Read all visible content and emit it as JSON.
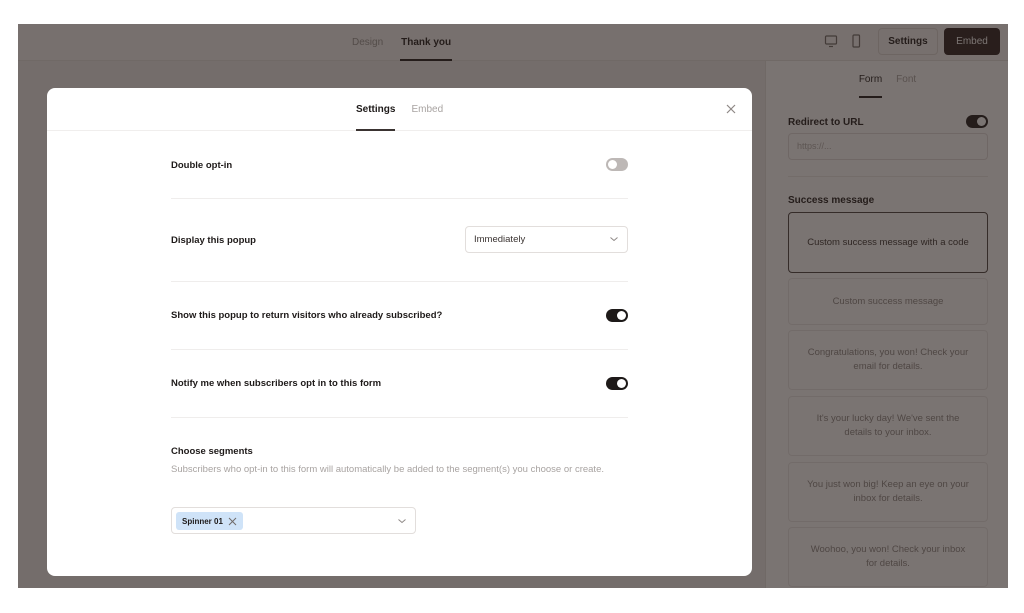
{
  "topbar": {
    "tabs": [
      {
        "label": "Design",
        "active": false
      },
      {
        "label": "Thank you",
        "active": true
      }
    ],
    "device_icons": [
      "desktop-icon",
      "mobile-icon"
    ],
    "settings_button": "Settings",
    "embed_button": "Embed"
  },
  "right_panel": {
    "tabs": [
      {
        "label": "Form",
        "active": true
      },
      {
        "label": "Font",
        "active": false
      }
    ],
    "redirect_label": "Redirect to URL",
    "redirect_enabled": true,
    "url_placeholder": "https://...",
    "success_label": "Success message",
    "messages": [
      {
        "text": "Custom success message with a code",
        "selected": true
      },
      {
        "text": "Custom success message",
        "selected": false
      },
      {
        "text": "Congratulations, you won! Check your email for details.",
        "selected": false
      },
      {
        "text": "It's your lucky day! We've sent the details to your inbox.",
        "selected": false
      },
      {
        "text": "You just won big! Keep an eye on your inbox for details.",
        "selected": false
      },
      {
        "text": "Woohoo, you won! Check your inbox for details.",
        "selected": false
      }
    ]
  },
  "modal": {
    "tabs": [
      {
        "label": "Settings",
        "active": true
      },
      {
        "label": "Embed",
        "active": false
      }
    ],
    "close_icon": "close-icon",
    "rows": {
      "double_optin": {
        "label": "Double opt-in",
        "enabled": false
      },
      "display_popup": {
        "label": "Display this popup",
        "value": "Immediately"
      },
      "return_visitors": {
        "label": "Show this popup to return visitors who already subscribed?",
        "enabled": true
      },
      "notify": {
        "label": "Notify me when subscribers opt in to this form",
        "enabled": true
      }
    },
    "segments": {
      "title": "Choose segments",
      "description": "Subscribers who opt-in to this form will automatically be added to the segment(s) you choose or create.",
      "selected": [
        "Spinner 01"
      ]
    }
  },
  "colors": {
    "primary_dark": "#1e1a19",
    "chip_blue": "#cfe3f8",
    "embed_button_bg": "#2c1e1e"
  }
}
